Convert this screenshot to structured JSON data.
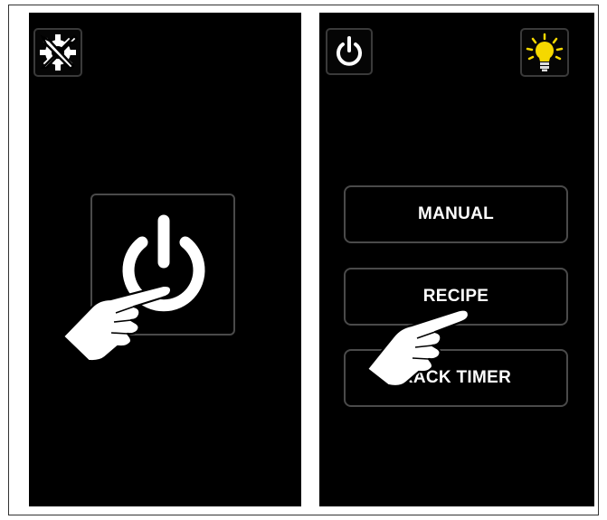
{
  "left_screen": {
    "settings_icon": "settings-wrench-gear-icon",
    "power_icon": "power-icon"
  },
  "right_screen": {
    "power_icon": "power-icon",
    "light_icon": "lightbulb-icon",
    "buttons": [
      {
        "label": "MANUAL"
      },
      {
        "label": "RECIPE"
      },
      {
        "label": "RACK TIMER"
      }
    ]
  },
  "colors": {
    "screen_bg": "#000000",
    "button_border": "#4a4a4a",
    "light_accent": "#f5d800",
    "hand_fill": "#ffffff"
  }
}
